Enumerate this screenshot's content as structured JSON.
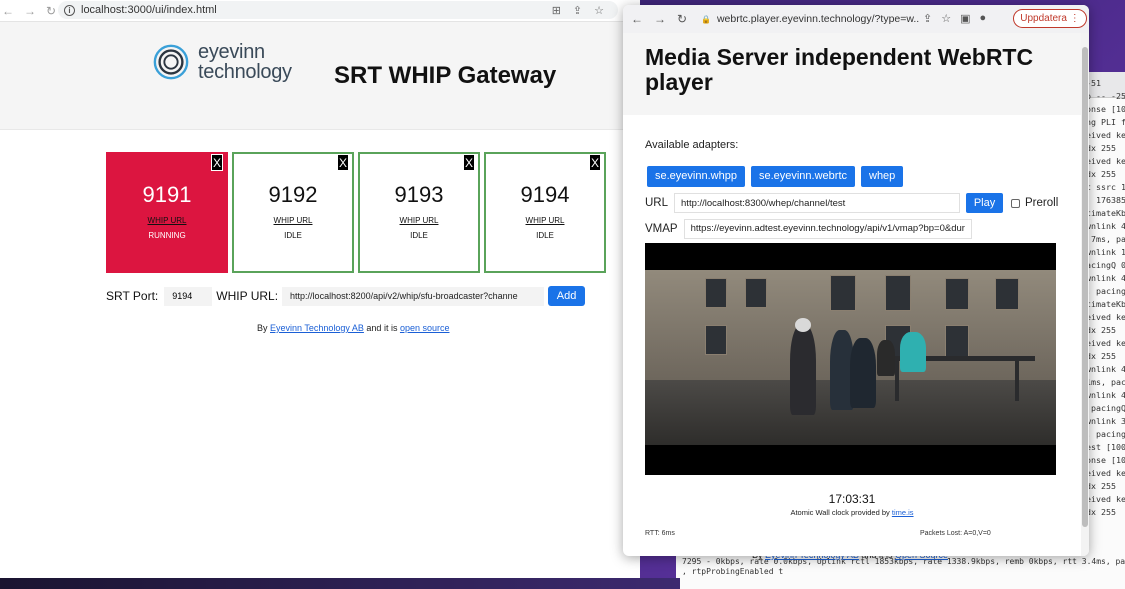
{
  "left_window": {
    "url": "localhost:3000/ui/index.html",
    "logo_text_line1": "eyevinn",
    "logo_text_line2": "technology",
    "title": "SRT WHIP Gateway",
    "cards": [
      {
        "port": "9191",
        "whip": "WHIP URL",
        "status": "RUNNING",
        "close": "X"
      },
      {
        "port": "9192",
        "whip": "WHIP URL",
        "status": "IDLE",
        "close": "X"
      },
      {
        "port": "9193",
        "whip": "WHIP URL",
        "status": "IDLE",
        "close": "X"
      },
      {
        "port": "9194",
        "whip": "WHIP URL",
        "status": "IDLE",
        "close": "X"
      }
    ],
    "form": {
      "srt_port_label": "SRT Port:",
      "srt_port_value": "9194",
      "whip_url_label": "WHIP URL:",
      "whip_url_value": "http://localhost:8200/api/v2/whip/sfu-broadcaster?channe",
      "add_label": "Add"
    },
    "footer": {
      "prefix": "By ",
      "company": "Eyevinn Technology AB",
      "middle": " and it is ",
      "link": "open source"
    }
  },
  "right_window": {
    "url": "webrtc.player.eyevinn.technology/?type=w...",
    "update_label": "Uppdatera",
    "title": "Media Server independent WebRTC player",
    "adapters_label": "Available adapters:",
    "adapters": [
      "se.eyevinn.whpp",
      "se.eyevinn.webrtc",
      "whep"
    ],
    "url_label": "URL",
    "url_value": "http://localhost:8300/whep/channel/test",
    "play_label": "Play",
    "preroll_label": "Preroll",
    "vmap_label": "VMAP",
    "vmap_value": "https://eyevinn.adtest.eyevinn.technology/api/v1/vmap?bp=0&dur",
    "clock": "17:03:31",
    "clock_note_prefix": "Atomic Wall clock provided by ",
    "clock_note_link": "time.is",
    "rtt": "RTT: 6ms",
    "packets": "Packets Lost: A=0,V=0"
  },
  "background_footer": {
    "prefix": "By ",
    "company": "Eyevinn Technology AB",
    "middle": " and it is ",
    "link": "Open Source"
  },
  "terminal": {
    "lines": [
      "-51",
      "p -- -25",
      "onse [10",
      "ng PLI f",
      "eived ke",
      "dx 255",
      "eived ke",
      "dx 255",
      "t ssrc 1",
      "  176385",
      "timateKb",
      "wnlink 4",
      ".7ms, pa",
      "wnlink 1",
      "acingQ 0",
      "wnlink 4",
      ", pacing",
      "timateKb",
      "eived ke",
      "dx 255",
      "eived ke",
      "dx 255",
      "wnlink 4",
      "1ms, pac",
      "wnlink 4",
      " pacingQ",
      "wnlink 3",
      ", pacing",
      "est [100",
      "onse [10",
      "eived ke",
      "dx 255",
      "eived ke",
      "dx 255"
    ],
    "bottom1": "7295 - 0kbps, rate 0.0kbps, Uplink rctl 1853kbps, rate 1338.9kbps, remb 0kbps, rtt 3.4ms, pacin",
    "bottom2": ", rtpProbingEnabled t"
  },
  "colors": {
    "accent": "#1a73e8",
    "running": "#dc1540",
    "idle_border": "#5aa35a"
  }
}
